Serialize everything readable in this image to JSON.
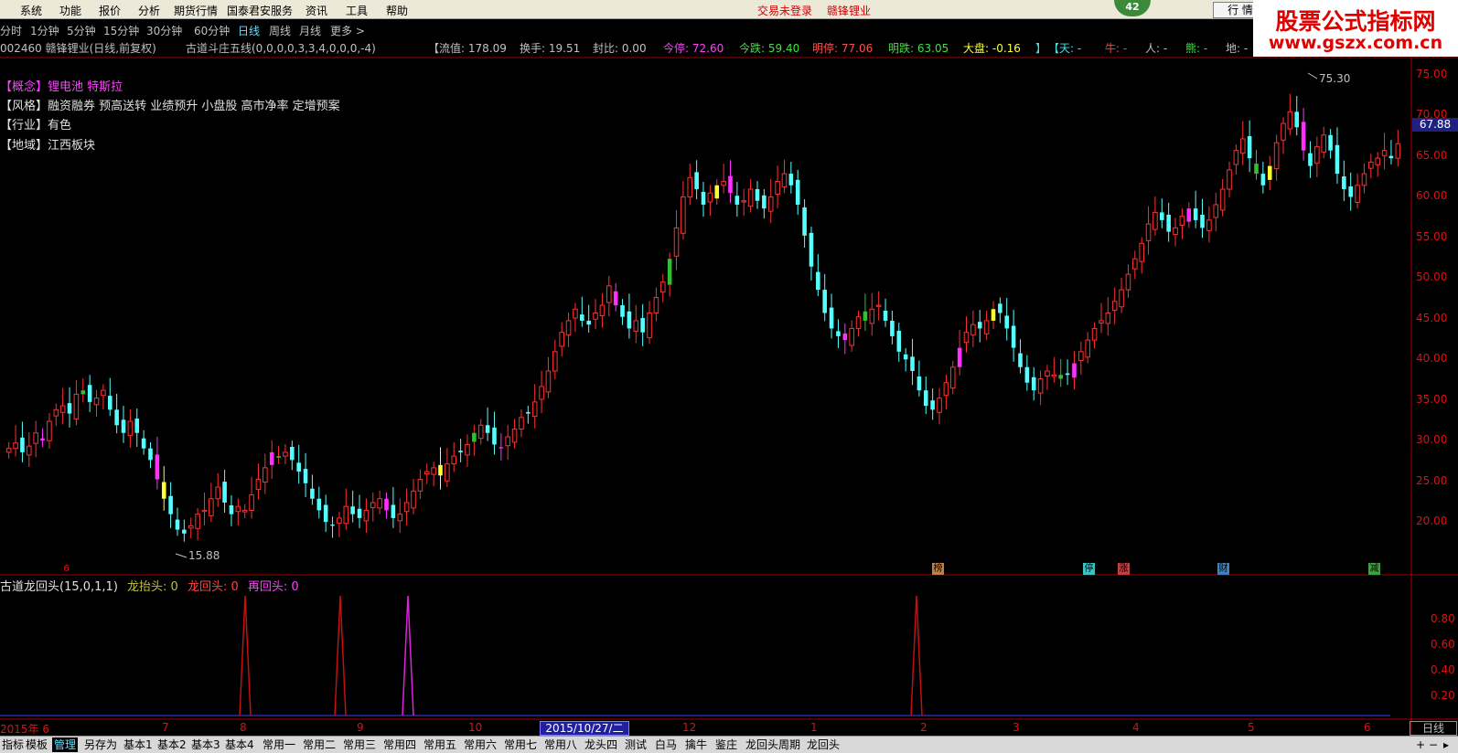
{
  "menubar": {
    "items": [
      "系统",
      "功能",
      "报价",
      "分析",
      "期货行情",
      "国泰君安服务",
      "资讯",
      "工具",
      "帮助"
    ],
    "status_login": "交易未登录",
    "status_stock": "赣锋锂业",
    "badge": "42",
    "hq_button": "行 情"
  },
  "brand": {
    "line1": "股票公式指标网",
    "line2": "www.gszx.com.cn"
  },
  "periods": [
    "分时",
    "1分钟",
    "5分钟",
    "15分钟",
    "30分钟",
    "60分钟",
    "日线",
    "周线",
    "月线",
    "更多 >"
  ],
  "active_period": "日线",
  "info": {
    "code_name": "002460 赣锋锂业(日线,前复权)",
    "indicator": "古道斗庄五线(0,0,0,0,3,3,4,0,0,0,-4)",
    "liutong": "【流值: 178.09",
    "huanshou": "换手: 19.51",
    "fengbi": "封比: 0.00",
    "jinting": "今停: 72.60",
    "jindie": "今跌: 59.40",
    "mingting": "明停: 77.06",
    "mingdie": "明跌: 63.05",
    "dapan": "大盘: -0.16",
    "close_bracket": "】",
    "tian": "【天: -",
    "niu": "牛: -",
    "ren": "人: -",
    "xiong": "熊: -",
    "di": "地: -"
  },
  "tags": {
    "concept_label": "【概念】",
    "concept_value": "锂电池 特斯拉",
    "style": "【风格】融资融券 预高送转 业绩预升 小盘股 高市净率 定增预案",
    "industry": "【行业】有色",
    "region": "【地域】江西板块"
  },
  "price_axis": [
    "75.00",
    "70.00",
    "65.00",
    "60.00",
    "55.00",
    "50.00",
    "45.00",
    "40.00",
    "35.00",
    "30.00",
    "25.00",
    "20.00"
  ],
  "current_price": "67.88",
  "high_label": "75.30",
  "low_label": "15.88",
  "markers": [
    {
      "text": "6",
      "color": "#e01010"
    },
    {
      "text": "榜",
      "color": "#c08040"
    },
    {
      "text": "停",
      "color": "#40c0c0"
    },
    {
      "text": "涨",
      "color": "#c04040"
    },
    {
      "text": "财",
      "color": "#4080c0"
    },
    {
      "text": "减",
      "color": "#40a040"
    }
  ],
  "indicator_panel": {
    "title": "古道龙回头(15,0,1,1)",
    "s1": "龙抬头: 0",
    "s2": "龙回头: 0",
    "s3": "再回头: 0",
    "axis": [
      "0.80",
      "0.60",
      "0.40",
      "0.20"
    ]
  },
  "x_axis": [
    "2015年 6",
    "7",
    "8",
    "9",
    "10",
    "12",
    "1",
    "2",
    "3",
    "4",
    "5",
    "6"
  ],
  "cursor_date": "2015/10/27/二",
  "period_box": "日线",
  "tabs": [
    "指标",
    "模板",
    "管理",
    "另存为",
    "基本1",
    "基本2",
    "基本3",
    "基本4",
    "常用一",
    "常用二",
    "常用三",
    "常用四",
    "常用五",
    "常用六",
    "常用七",
    "常用八",
    "龙头四",
    "测试",
    "白马",
    "擒牛",
    "鉴庄",
    "龙回头周期",
    "龙回头"
  ],
  "active_tab": "管理",
  "chart_data": {
    "type": "candlestick",
    "ylim": [
      15,
      77
    ],
    "high": 75.3,
    "low": 15.88,
    "last": 67.88,
    "closes": [
      28.5,
      29.2,
      28.0,
      28.8,
      30.5,
      29.5,
      32.0,
      33.5,
      34.0,
      33.0,
      35.5,
      36.0,
      34.5,
      35.0,
      36.0,
      33.5,
      31.5,
      30.5,
      32.0,
      30.5,
      28.5,
      27.0,
      24.5,
      22.0,
      20.0,
      18.0,
      17.5,
      18.5,
      20.0,
      20.5,
      22.0,
      23.5,
      21.5,
      20.0,
      21.0,
      20.5,
      22.5,
      24.5,
      26.0,
      28.0,
      27.5,
      28.0,
      27.0,
      25.5,
      24.0,
      22.0,
      20.5,
      19.0,
      18.5,
      19.5,
      21.0,
      20.0,
      19.5,
      20.5,
      21.5,
      22.0,
      20.5,
      19.5,
      20.0,
      21.5,
      23.0,
      24.5,
      25.5,
      26.0,
      25.0,
      26.5,
      27.5,
      28.0,
      29.0,
      30.5,
      31.5,
      30.5,
      29.0,
      28.5,
      30.0,
      31.0,
      32.5,
      33.0,
      34.5,
      36.5,
      38.5,
      41.0,
      43.5,
      45.0,
      46.5,
      45.0,
      44.5,
      46.0,
      47.0,
      49.5,
      47.0,
      45.5,
      44.0,
      45.0,
      43.5,
      46.0,
      48.0,
      50.0,
      53.0,
      57.0,
      61.0,
      63.5,
      62.0,
      60.0,
      61.5,
      62.5,
      63.0,
      61.5,
      60.0,
      60.5,
      62.0,
      60.5,
      59.5,
      61.0,
      63.0,
      64.0,
      62.5,
      60.0,
      56.0,
      52.0,
      49.0,
      46.0,
      44.0,
      43.0,
      42.5,
      44.0,
      45.5,
      45.0,
      46.5,
      47.0,
      45.0,
      43.0,
      41.0,
      40.0,
      38.5,
      36.0,
      34.0,
      33.5,
      35.0,
      37.0,
      39.0,
      41.5,
      43.5,
      44.5,
      44.0,
      45.0,
      46.5,
      46.0,
      44.0,
      41.5,
      39.0,
      37.0,
      36.0,
      37.5,
      38.5,
      38.0,
      37.5,
      38.0,
      39.5,
      41.0,
      42.5,
      44.0,
      45.0,
      46.0,
      47.5,
      49.0,
      51.0,
      53.0,
      55.0,
      57.5,
      59.0,
      58.0,
      56.5,
      57.0,
      58.5,
      59.5,
      58.0,
      57.0,
      58.0,
      60.0,
      62.0,
      64.5,
      67.0,
      68.5,
      66.0,
      64.0,
      62.5,
      65.0,
      68.0,
      70.5,
      72.0,
      70.0,
      67.0,
      65.0,
      67.5,
      69.0,
      67.0,
      64.0,
      62.0,
      61.0,
      62.5,
      64.0,
      65.5,
      66.0,
      67.0,
      66.0,
      67.88
    ]
  }
}
